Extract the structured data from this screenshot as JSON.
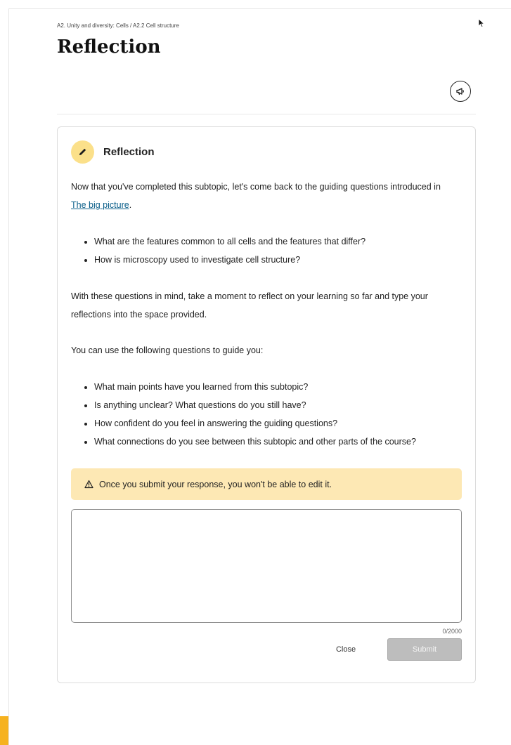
{
  "breadcrumb": "A2. Unity and diversity: Cells / A2.2 Cell structure",
  "page_title": "Reflection",
  "header": {
    "announce_icon": "megaphone-icon"
  },
  "card": {
    "icon": "pencil-icon",
    "title": "Reflection",
    "intro_before_link": "Now that you've completed this subtopic, let's come back to the guiding questions introduced in ",
    "intro_link": "The big picture",
    "intro_after_link": ".",
    "guiding_questions": [
      "What are the features common to all cells and the features that differ?",
      "How is microscopy used to investigate cell structure?"
    ],
    "reflect_prompt": "With these questions in mind, take a moment to reflect on your learning so far and type your reflections into the space provided.",
    "guide_intro": "You can use the following questions to guide you:",
    "guide_questions": [
      "What main points have you learned from this subtopic?",
      "Is anything unclear? What questions do you still have?",
      "How confident do you feel in answering the guiding questions?",
      "What connections do you see between this subtopic and other parts of the course?"
    ],
    "warning_icon": "warning-triangle-icon",
    "warning": "Once you submit your response, you won't be able to edit it.",
    "response_value": "",
    "char_count": "0/2000",
    "close_label": "Close",
    "submit_label": "Submit"
  },
  "colors": {
    "accent": "#f6b21f",
    "icon_circle": "#fbe08a",
    "warning_bg": "#fde8b4",
    "link": "#0b5f8a",
    "submit_disabled": "#bdbdbd"
  }
}
